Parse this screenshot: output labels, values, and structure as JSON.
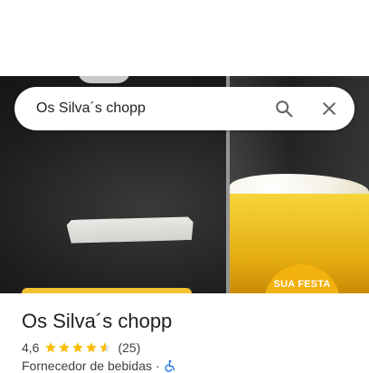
{
  "search": {
    "query": "Os Silva´s chopp",
    "search_icon": "search-icon",
    "close_icon": "close-icon"
  },
  "hero": {
    "badge_text": "SUA FESTA"
  },
  "place": {
    "name": "Os Silva´s chopp",
    "rating": "4,6",
    "rating_value": 4.6,
    "review_count": "(25)",
    "category": "Fornecedor de bebidas",
    "separator": "·",
    "accessibility_icon": "wheelchair-icon"
  },
  "colors": {
    "star": "#fbbc04",
    "star_empty": "#dadce0",
    "text_primary": "#202124",
    "text_secondary": "#3c4043",
    "accessibility": "#1a73e8"
  }
}
